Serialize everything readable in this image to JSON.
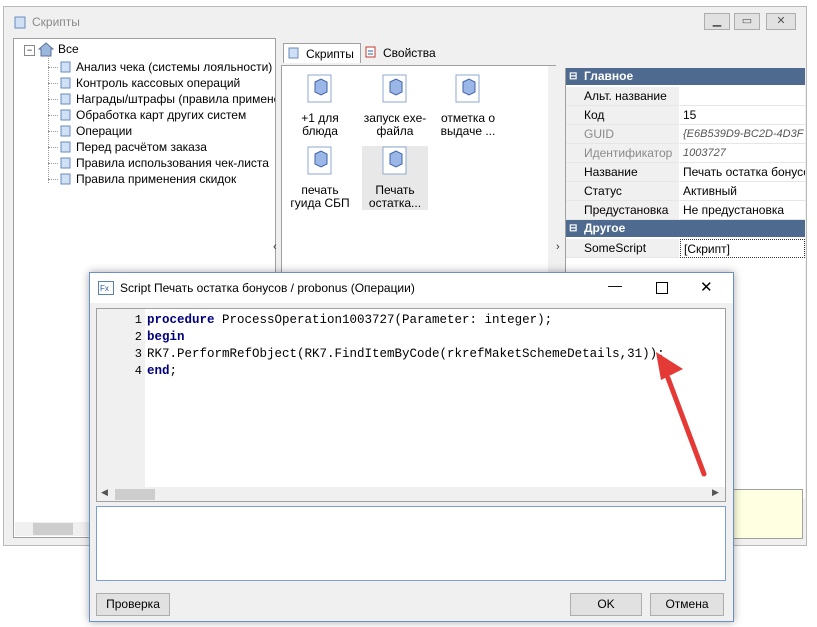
{
  "main_window": {
    "title": "Скрипты",
    "tree": {
      "root": "Все",
      "items": [
        "Анализ чека (системы лояльности)",
        "Контроль кассовых операций",
        "Награды/штрафы (правила применен",
        "Обработка карт других систем",
        "Операции",
        "Перед расчётом заказа",
        "Правила использования чек-листа",
        "Правила применения скидок"
      ]
    },
    "tabs": [
      "Скрипты",
      "Свойства"
    ],
    "scripts": [
      {
        "label": "+1 для блюда"
      },
      {
        "label": "запуск exe-файла"
      },
      {
        "label": "отметка о выдаче ..."
      },
      {
        "label": "печать гуида СБП"
      },
      {
        "label": "Печать остатка..."
      }
    ],
    "properties": {
      "section_main": "Главное",
      "rows_main": [
        {
          "key": "Альт. название",
          "value": ""
        },
        {
          "key": "Код",
          "value": "15"
        },
        {
          "key": "GUID",
          "value": "{E6B539D9-BC2D-4D3F"
        },
        {
          "key": "Идентификатор",
          "value": "1003727"
        },
        {
          "key": "Название",
          "value": "Печать остатка бонусо"
        },
        {
          "key": "Статус",
          "value": "Активный"
        },
        {
          "key": "Предустановка",
          "value": "Не предустановка"
        }
      ],
      "section_other": "Другое",
      "rows_other": [
        {
          "key": "SomeScript",
          "value": "[Скрипт]"
        }
      ]
    }
  },
  "dialog": {
    "title": "Script Печать остатка бонусов / probonus (Операции)",
    "code_lines": [
      {
        "num": "1",
        "kw": "procedure",
        "rest": " ProcessOperation1003727(Parameter: integer);"
      },
      {
        "num": "2",
        "kw": "begin",
        "rest": ""
      },
      {
        "num": "3",
        "kw": "",
        "rest": "RK7.PerformRefObject(RK7.FindItemByCode(rkrefMaketSchemeDetails,31));"
      },
      {
        "num": "4",
        "kw": "end",
        "rest": ";"
      }
    ],
    "check_button": "Проверка",
    "ok_button": "OK",
    "cancel_button": "Отмена"
  },
  "colors": {
    "accent": "#4f6a8f",
    "keyword": "#00007f",
    "arrow": "#e53935"
  }
}
